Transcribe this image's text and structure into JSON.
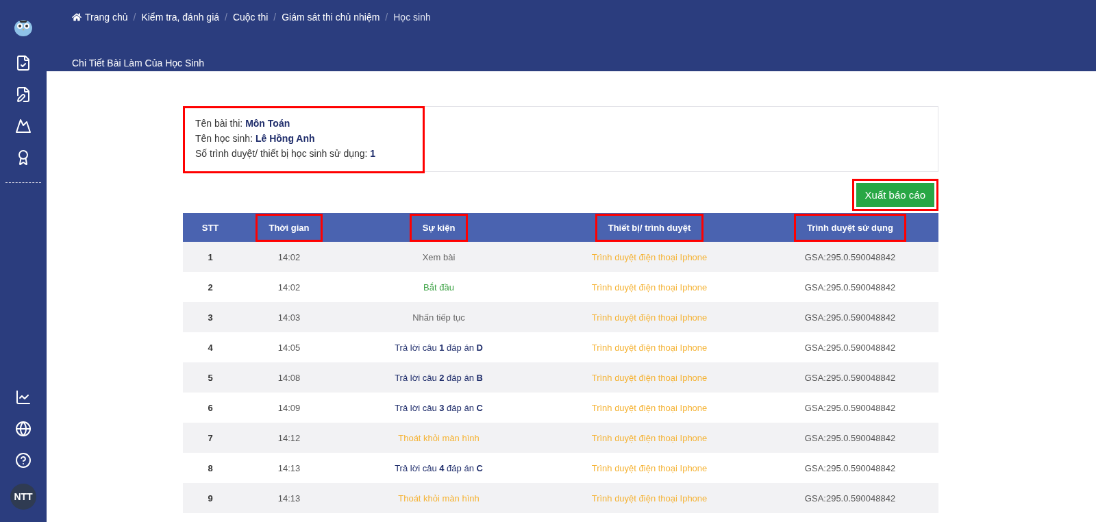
{
  "breadcrumb": [
    {
      "label": "Trang chủ",
      "home": true
    },
    {
      "separator": "/",
      "label": "Kiểm tra, đánh giá",
      "home": false
    },
    {
      "separator": "/",
      "label": "Cuộc thi",
      "home": false
    },
    {
      "separator": "/",
      "label": "Giám sát thi chủ nhiệm",
      "home": false
    },
    {
      "separator": "/",
      "label": "Học sinh",
      "home": false
    }
  ],
  "page_title": "Chi Tiết Bài Làm Của Học Sinh",
  "sidebar": {
    "avatar": "NTT"
  },
  "info": {
    "highlighted": true,
    "lines": [
      {
        "label": "Tên bài thi:",
        "value": "Môn Toán"
      },
      {
        "label": "Tên học sinh:",
        "value": "Lê Hồng Anh"
      },
      {
        "label": "Số trình duyệt/ thiết bị học sinh sử dụng:",
        "value": "1"
      }
    ]
  },
  "export_button": {
    "label": "Xuất báo cáo",
    "highlighted": true
  },
  "table": {
    "columns": [
      {
        "label": "STT",
        "highlighted": false
      },
      {
        "label": "Thời gian",
        "highlighted": true
      },
      {
        "label": "Sự kiện",
        "highlighted": true
      },
      {
        "label": "Thiết bị/ trình duyệt",
        "highlighted": true
      },
      {
        "label": "Trình duyệt sử dụng",
        "highlighted": true
      }
    ],
    "rows": [
      {
        "stt": "1",
        "time": "14:02",
        "event": "Xem bài",
        "kind": "view",
        "device": "Trình duyệt điện thoại Iphone",
        "browser": "GSA:295.0.590048842"
      },
      {
        "stt": "2",
        "time": "14:02",
        "event": "Bắt đầu",
        "kind": "start",
        "device": "Trình duyệt điện thoại Iphone",
        "browser": "GSA:295.0.590048842"
      },
      {
        "stt": "3",
        "time": "14:03",
        "event": "Nhấn tiếp tục",
        "kind": "view",
        "device": "Trình duyệt điện thoại Iphone",
        "browser": "GSA:295.0.590048842"
      },
      {
        "stt": "4",
        "time": "14:05",
        "event": "Trả lời câu **1** đáp án **D**",
        "kind": "answer",
        "device": "Trình duyệt điện thoại Iphone",
        "browser": "GSA:295.0.590048842"
      },
      {
        "stt": "5",
        "time": "14:08",
        "event": "Trả lời câu **2** đáp án **B**",
        "kind": "answer",
        "device": "Trình duyệt điện thoại Iphone",
        "browser": "GSA:295.0.590048842"
      },
      {
        "stt": "6",
        "time": "14:09",
        "event": "Trả lời câu **3** đáp án **C**",
        "kind": "answer",
        "device": "Trình duyệt điện thoại Iphone",
        "browser": "GSA:295.0.590048842"
      },
      {
        "stt": "7",
        "time": "14:12",
        "event": "Thoát khỏi màn hình",
        "kind": "exit",
        "device": "Trình duyệt điện thoại Iphone",
        "browser": "GSA:295.0.590048842"
      },
      {
        "stt": "8",
        "time": "14:13",
        "event": "Trả lời câu **4** đáp án **C**",
        "kind": "answer",
        "device": "Trình duyệt điện thoại Iphone",
        "browser": "GSA:295.0.590048842"
      },
      {
        "stt": "9",
        "time": "14:13",
        "event": "Thoát khỏi màn hình",
        "kind": "exit",
        "device": "Trình duyệt điện thoại Iphone",
        "browser": "GSA:295.0.590048842"
      }
    ]
  }
}
